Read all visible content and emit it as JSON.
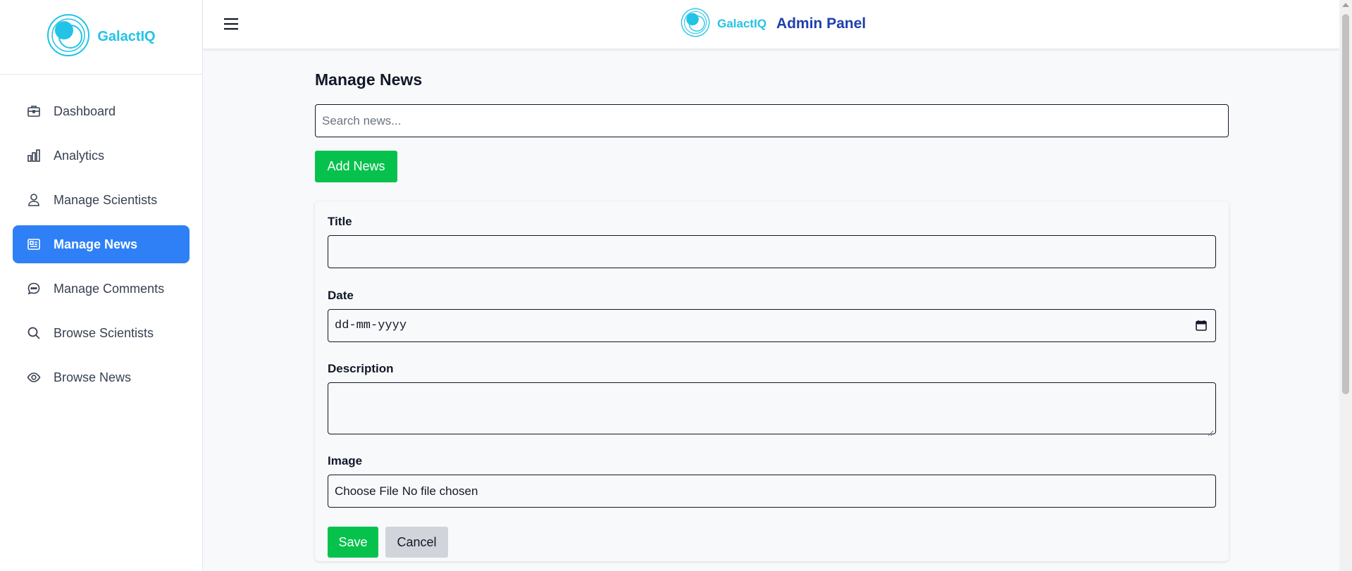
{
  "brand": {
    "name": "GalactIQ"
  },
  "header": {
    "brand": "GalactIQ",
    "title": "Admin Panel"
  },
  "sidebar": {
    "items": [
      {
        "label": "Dashboard",
        "icon": "briefcase-icon"
      },
      {
        "label": "Analytics",
        "icon": "bar-chart-icon"
      },
      {
        "label": "Manage Scientists",
        "icon": "user-icon"
      },
      {
        "label": "Manage News",
        "icon": "newspaper-icon",
        "active": true
      },
      {
        "label": "Manage Comments",
        "icon": "chat-bubble-icon"
      },
      {
        "label": "Browse Scientists",
        "icon": "search-icon"
      },
      {
        "label": "Browse News",
        "icon": "eye-icon"
      }
    ]
  },
  "main": {
    "title": "Manage News",
    "search_placeholder": "Search news...",
    "add_button": "Add News",
    "form": {
      "title_label": "Title",
      "title_value": "",
      "date_label": "Date",
      "date_placeholder": "dd-mm-yyyy",
      "description_label": "Description",
      "description_value": "",
      "image_label": "Image",
      "file_button": "Choose File",
      "file_status": "No file chosen",
      "save_button": "Save",
      "cancel_button": "Cancel"
    }
  },
  "colors": {
    "brand": "#22c3e6",
    "header_title": "#1e40af",
    "active_nav": "#2f80f6",
    "primary_button": "#06c24c",
    "cancel_button": "#d1d5db"
  }
}
